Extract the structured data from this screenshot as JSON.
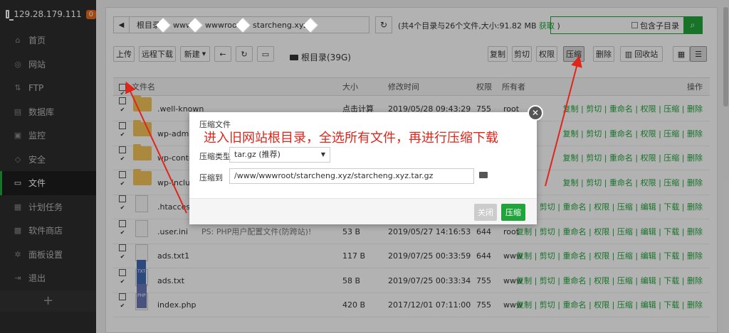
{
  "sidebar": {
    "ip": "129.28.179.111",
    "badge": "0",
    "items": [
      {
        "label": "首页",
        "icon": "home-icon",
        "glyph": "⌂"
      },
      {
        "label": "网站",
        "icon": "globe-icon",
        "glyph": "◎"
      },
      {
        "label": "FTP",
        "icon": "ftp-icon",
        "glyph": "⇅"
      },
      {
        "label": "数据库",
        "icon": "database-icon",
        "glyph": "▤"
      },
      {
        "label": "监控",
        "icon": "monitor-icon",
        "glyph": "▣"
      },
      {
        "label": "安全",
        "icon": "shield-icon",
        "glyph": "◇"
      },
      {
        "label": "文件",
        "icon": "folder-icon",
        "glyph": "▭"
      },
      {
        "label": "计划任务",
        "icon": "calendar-icon",
        "glyph": "▦"
      },
      {
        "label": "软件商店",
        "icon": "grid-icon",
        "glyph": "▩"
      },
      {
        "label": "面板设置",
        "icon": "gear-icon",
        "glyph": "✲"
      },
      {
        "label": "退出",
        "icon": "logout-icon",
        "glyph": "⇥"
      }
    ],
    "add": "+"
  },
  "path": {
    "crumbs": [
      "根目录",
      "www",
      "wwwroot",
      "starcheng.xyz"
    ],
    "summary_prefix": "(共4个目录与26个文件,大小:91.82 MB",
    "summary_link": "获取",
    "summary_suffix": ")"
  },
  "search": {
    "include_sub": "包含子目录"
  },
  "toolbar": {
    "upload": "上传",
    "remote_download": "远程下载",
    "new": "新建",
    "root": "根目录(39G)",
    "copy": "复制",
    "cut": "剪切",
    "permission": "权限",
    "compress": "压缩",
    "delete": "删除",
    "recycle": "回收站"
  },
  "table": {
    "headers": {
      "name": "文件名",
      "size": "大小",
      "mtime": "修改时间",
      "perm": "权限",
      "owner": "所有者",
      "ops": "操作"
    },
    "rows": [
      {
        "type": "folder",
        "name": ".well-known",
        "size": "点击计算",
        "mtime": "2019/05/28 09:43:29",
        "perm": "755",
        "owner": "root",
        "ps": "",
        "ops": "复制 | 剪切 | 重命名 | 权限 | 压缩 | 删除"
      },
      {
        "type": "folder",
        "name": "wp-admin",
        "size": "",
        "mtime": "",
        "perm": "",
        "owner": "",
        "ps": "",
        "ops": "复制 | 剪切 | 重命名 | 权限 | 压缩 | 删除"
      },
      {
        "type": "folder",
        "name": "wp-content",
        "size": "",
        "mtime": "",
        "perm": "",
        "owner": "",
        "ps": "",
        "ops": "复制 | 剪切 | 重命名 | 权限 | 压缩 | 删除"
      },
      {
        "type": "folder",
        "name": "wp-includes",
        "size": "",
        "mtime": "",
        "perm": "",
        "owner": "",
        "ps": "",
        "ops": "复制 | 剪切 | 重命名 | 权限 | 压缩 | 删除"
      },
      {
        "type": "file",
        "name": ".htaccess",
        "size": "",
        "mtime": "",
        "perm": "",
        "owner": "",
        "ps": "",
        "ops": "复制 | 剪切 | 重命名 | 权限 | 压缩 | 编辑 | 下载 | 删除"
      },
      {
        "type": "file",
        "name": ".user.ini",
        "size": "53 B",
        "mtime": "2019/05/27 14:16:53",
        "perm": "644",
        "owner": "root",
        "ps": "PS: PHP用户配置文件(防跨站)!",
        "ops": "复制 | 剪切 | 重命名 | 权限 | 压缩 | 编辑 | 下载 | 删除"
      },
      {
        "type": "file",
        "name": "ads.txt1",
        "size": "117 B",
        "mtime": "2019/07/25 00:33:59",
        "perm": "644",
        "owner": "www",
        "ps": "",
        "ops": "复制 | 剪切 | 重命名 | 权限 | 压缩 | 编辑 | 下载 | 删除"
      },
      {
        "type": "txt",
        "name": "ads.txt",
        "size": "58 B",
        "mtime": "2019/07/25 00:33:34",
        "perm": "755",
        "owner": "www",
        "ps": "",
        "ops": "复制 | 剪切 | 重命名 | 权限 | 压缩 | 编辑 | 下载 | 删除"
      },
      {
        "type": "php",
        "name": "index.php",
        "size": "420 B",
        "mtime": "2017/12/01 07:11:00",
        "perm": "755",
        "owner": "www",
        "ps": "",
        "ops": "复制 | 剪切 | 重命名 | 权限 | 压缩 | 编辑 | 下载 | 删除"
      }
    ]
  },
  "dialog": {
    "title": "压缩文件",
    "annotation": "进入旧网站根目录，全选所有文件，再进行压缩下载",
    "type_label": "压缩类型",
    "type_value": "tar.gz (推荐)",
    "dest_label": "压缩到",
    "dest_value": "/www/wwwroot/starcheng.xyz/starcheng.xyz.tar.gz",
    "close_btn": "关闭",
    "compress_btn": "压缩"
  },
  "colors": {
    "accent": "#20a53a",
    "annotation": "#e0251b",
    "badge": "#e8681a"
  }
}
